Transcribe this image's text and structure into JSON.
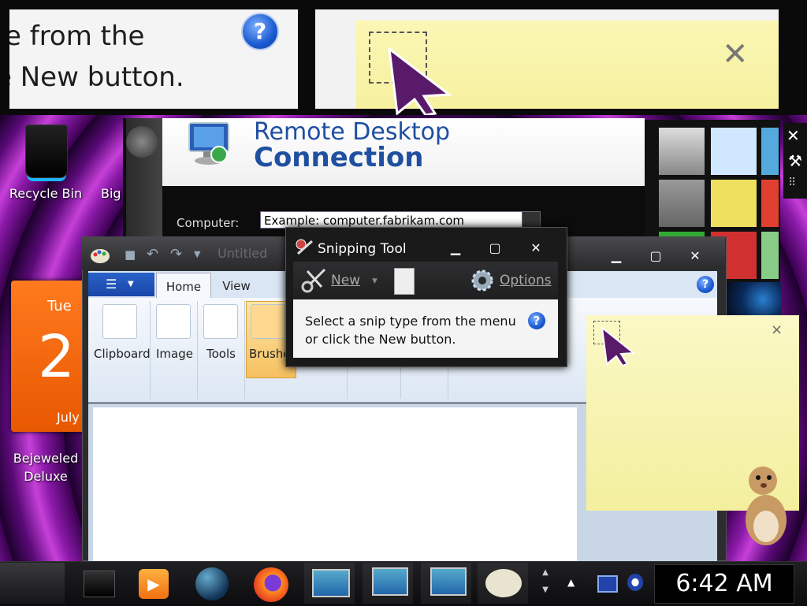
{
  "zoom_banner": {
    "line1": "e from the",
    "line2": "e New button.",
    "help_glyph": "?",
    "close_glyph": "✕"
  },
  "desktop": {
    "icons": [
      {
        "label": "Recycle Bin",
        "icon": "recycle-bin-icon"
      },
      {
        "label": "Big",
        "icon": "shortcut-icon"
      },
      {
        "label": "Bejeweled",
        "label2": "Deluxe",
        "icon": "bejeweled-icon"
      }
    ]
  },
  "calendar_gadget": {
    "day": "Tue",
    "date": "2",
    "month": "July"
  },
  "remote_desktop": {
    "title_top": "Remote Desktop",
    "title_bottom": "Connection",
    "computer_label": "Computer:",
    "computer_value": "Example: computer.fabrikam.com"
  },
  "paint": {
    "title": "Untitled",
    "tabs": [
      {
        "label": "Home"
      },
      {
        "label": "View"
      }
    ],
    "groups": [
      {
        "label": "Clipboard",
        "icon": "clipboard-icon"
      },
      {
        "label": "Image",
        "icon": "image-select-icon"
      },
      {
        "label": "Tools",
        "icon": "tools-icon"
      },
      {
        "label": "Brushes",
        "icon": "brush-icon"
      }
    ]
  },
  "snipping_tool": {
    "title": "Snipping Tool",
    "new_label": "New",
    "options_label": "Options",
    "message": "Select a snip type from the menu or click the New button.",
    "help_glyph": "?"
  },
  "sticky_note": {
    "close_glyph": "×"
  },
  "taskbar": {
    "apps": [
      "desktop-icon",
      "media-player-icon",
      "globe-icon",
      "firefox-icon",
      "computer-icon",
      "remote-desktop-icon",
      "remote-connection-icon",
      "paint-icon"
    ],
    "clock": "6:42 AM"
  },
  "colors": {
    "accent": "#1f4fa0",
    "note": "#f6f0a0",
    "wallpaper": "#8a1aa8",
    "calendar": "#ff7a1e"
  }
}
